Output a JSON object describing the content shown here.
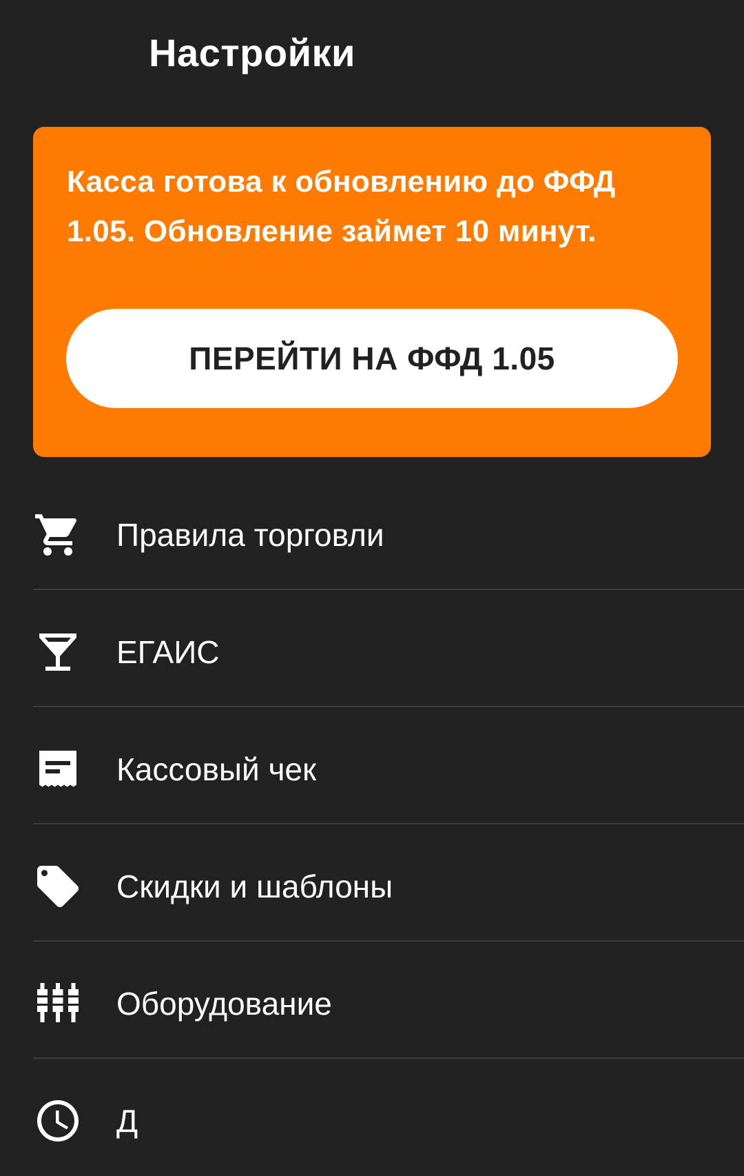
{
  "header": {
    "title": "Настройки"
  },
  "banner": {
    "text": "Касса готова к обновлению до ФФД 1.05. Обновление займет 10 минут.",
    "button_label": "ПЕРЕЙТИ НА ФФД 1.05",
    "background_color": "#ff7b00"
  },
  "menu": {
    "items": [
      {
        "label": "Правила торговли",
        "icon": "cart-icon"
      },
      {
        "label": "ЕГАИС",
        "icon": "cocktail-glass-icon"
      },
      {
        "label": "Кассовый чек",
        "icon": "receipt-icon"
      },
      {
        "label": "Скидки и шаблоны",
        "icon": "tag-icon"
      },
      {
        "label": "Оборудование",
        "icon": "equipment-icon"
      },
      {
        "label": "Д",
        "icon": "clock-icon"
      }
    ]
  },
  "colors": {
    "background": "#212121",
    "divider": "#3b3b3b",
    "text": "#ffffff"
  }
}
